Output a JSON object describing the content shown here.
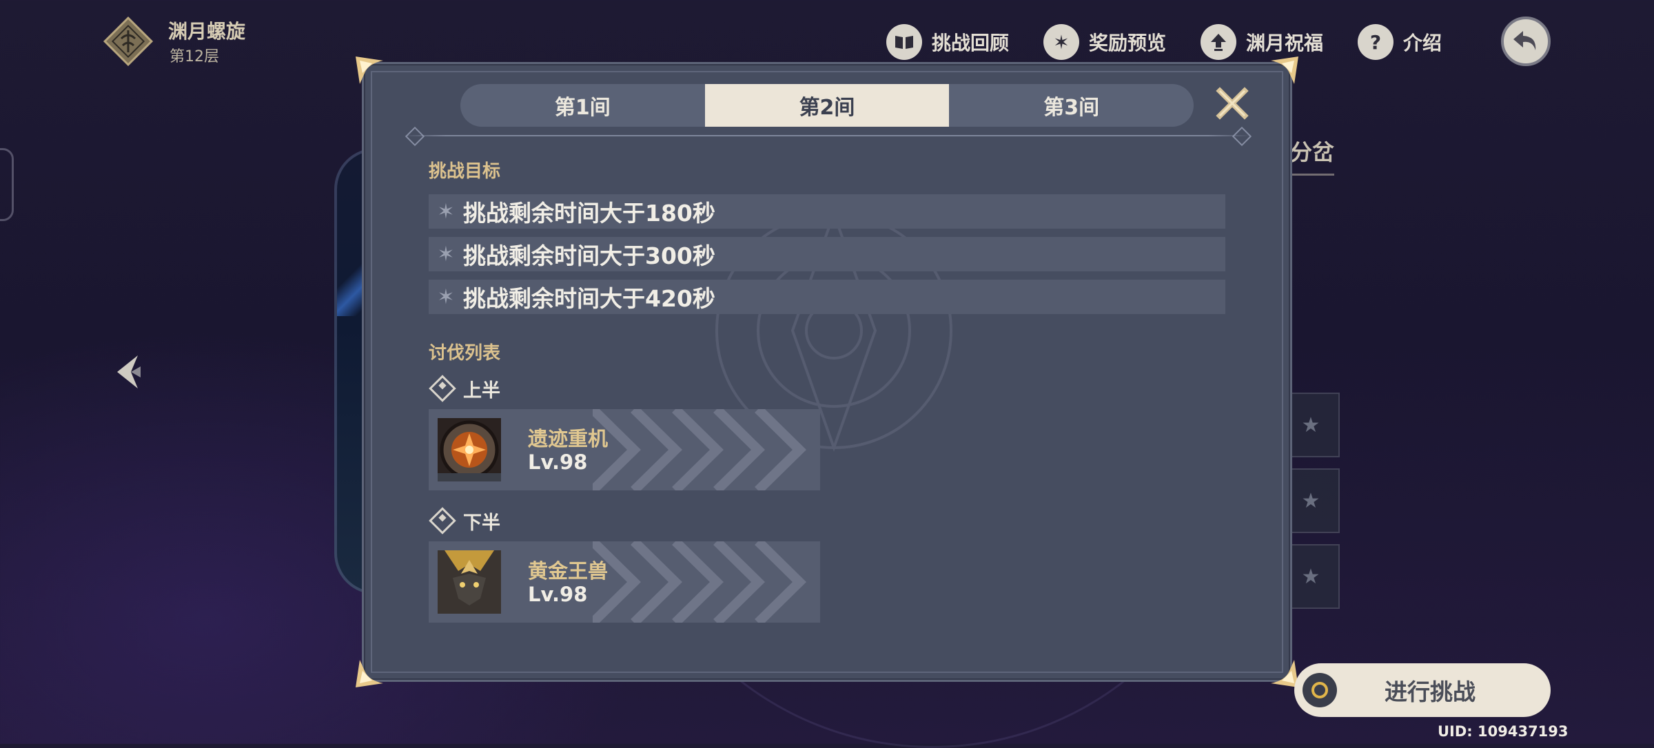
{
  "header": {
    "title": "渊月螺旋",
    "floor": "第12层"
  },
  "top_menu": [
    {
      "label": "挑战回顾",
      "icon": "book-icon"
    },
    {
      "label": "奖励预览",
      "icon": "star-badge-icon"
    },
    {
      "label": "渊月祝福",
      "icon": "upload-arrow-icon"
    },
    {
      "label": "介绍",
      "icon": "question-icon"
    }
  ],
  "background": {
    "behind_tab_label": "分岔"
  },
  "modal": {
    "tabs": [
      {
        "label": "第1间",
        "active": false
      },
      {
        "label": "第2间",
        "active": true
      },
      {
        "label": "第3间",
        "active": false
      }
    ],
    "challenge_goal_title": "挑战目标",
    "goals": [
      "挑战剩余时间大于180秒",
      "挑战剩余时间大于300秒",
      "挑战剩余时间大于420秒"
    ],
    "enemy_list_title": "讨伐列表",
    "halves": [
      {
        "label": "上半",
        "enemy": {
          "name": "遗迹重机",
          "level": "Lv.98"
        }
      },
      {
        "label": "下半",
        "enemy": {
          "name": "黄金王兽",
          "level": "Lv.98"
        }
      }
    ]
  },
  "start_button_label": "进行挑战",
  "uid": "UID: 109437193",
  "colors": {
    "accent_gold": "#dcc28e",
    "panel": "#464d60",
    "tab_active": "#ece5d8"
  }
}
